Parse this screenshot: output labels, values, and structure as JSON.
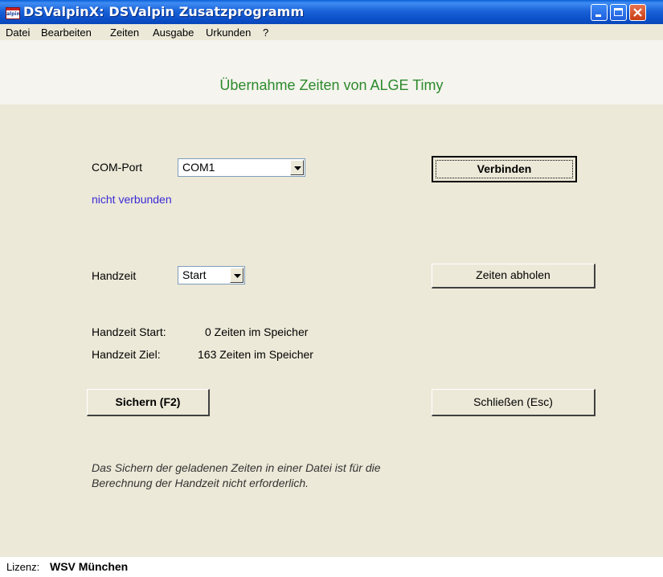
{
  "window": {
    "title": "DSValpinX: DSValpin Zusatzprogramm",
    "icon_text": "alpin"
  },
  "menu": [
    "Datei",
    "Bearbeiten",
    "Zeiten",
    "Ausgabe",
    "Urkunden",
    "?"
  ],
  "heading": "Übernahme Zeiten von ALGE Timy",
  "com_port": {
    "label": "COM-Port",
    "value": "COM1"
  },
  "connection_status": "nicht verbunden",
  "connect_button": "Verbinden",
  "handzeit": {
    "label": "Handzeit",
    "value": "Start"
  },
  "fetch_button": "Zeiten abholen",
  "memory": {
    "start_label": "Handzeit Start:",
    "start_value": "0 Zeiten im Speicher",
    "ziel_label": "Handzeit Ziel:",
    "ziel_value": "163 Zeiten im Speicher"
  },
  "save_button": "Sichern (F2)",
  "close_button": "Schließen (Esc)",
  "note": "Das Sichern der geladenen Zeiten in einer Datei ist für die Berechnung der Handzeit nicht erforderlich.",
  "license": {
    "label": "Lizenz:",
    "value": "WSV München"
  },
  "colors": {
    "heading": "#2d8a2d",
    "status": "#3a2ad6",
    "titlebar": "#0b4fc8"
  }
}
